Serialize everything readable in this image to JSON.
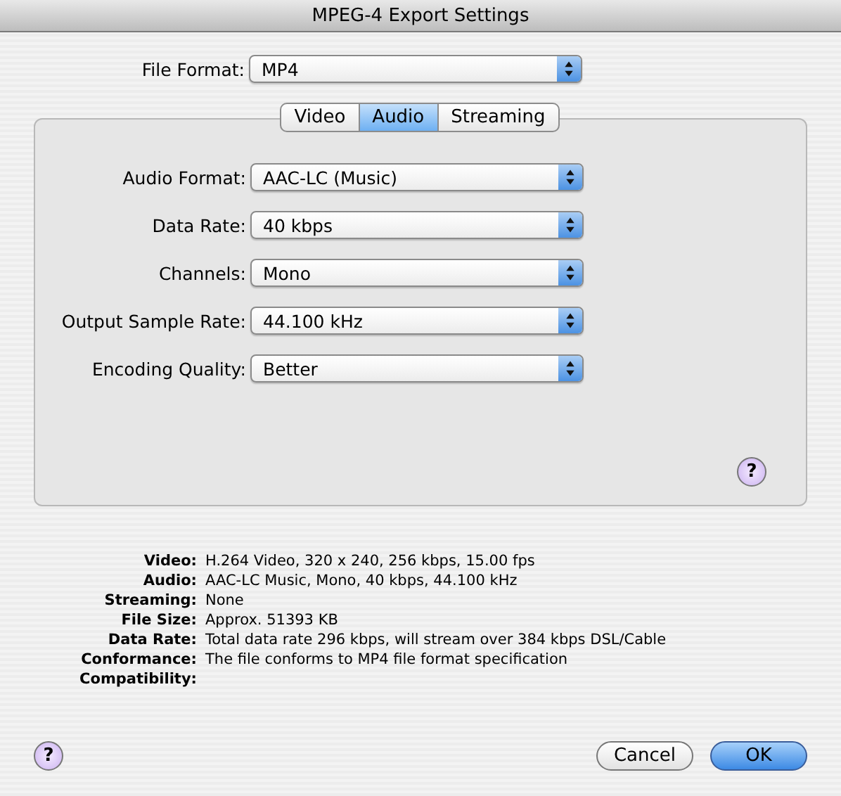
{
  "window": {
    "title": "MPEG-4 Export Settings"
  },
  "file_format": {
    "label": "File Format:",
    "value": "MP4"
  },
  "tabs": [
    {
      "label": "Video",
      "selected": false
    },
    {
      "label": "Audio",
      "selected": true
    },
    {
      "label": "Streaming",
      "selected": false
    }
  ],
  "audio_settings": [
    {
      "label": "Audio Format:",
      "value": "AAC-LC (Music)"
    },
    {
      "label": "Data Rate:",
      "value": "40 kbps"
    },
    {
      "label": "Channels:",
      "value": "Mono"
    },
    {
      "label": "Output Sample Rate:",
      "value": "44.100 kHz"
    },
    {
      "label": "Encoding Quality:",
      "value": "Better"
    }
  ],
  "panel_help": "?",
  "summary": [
    {
      "label": "Video:",
      "value": "H.264 Video, 320 x 240, 256 kbps, 15.00 fps"
    },
    {
      "label": "Audio:",
      "value": "AAC-LC Music, Mono, 40 kbps, 44.100 kHz"
    },
    {
      "label": "Streaming:",
      "value": "None"
    },
    {
      "label": "File Size:",
      "value": "Approx. 51393 KB"
    },
    {
      "label": "Data Rate:",
      "value": "Total data rate 296 kbps, will stream over 384 kbps DSL/Cable"
    },
    {
      "label": "Conformance:",
      "value": "The file conforms to MP4 file format specification"
    },
    {
      "label": "Compatibility:"
    }
  ],
  "help": "?",
  "buttons": [
    {
      "label": "Cancel",
      "kind": "normal"
    },
    {
      "label": "OK",
      "kind": "default"
    }
  ]
}
